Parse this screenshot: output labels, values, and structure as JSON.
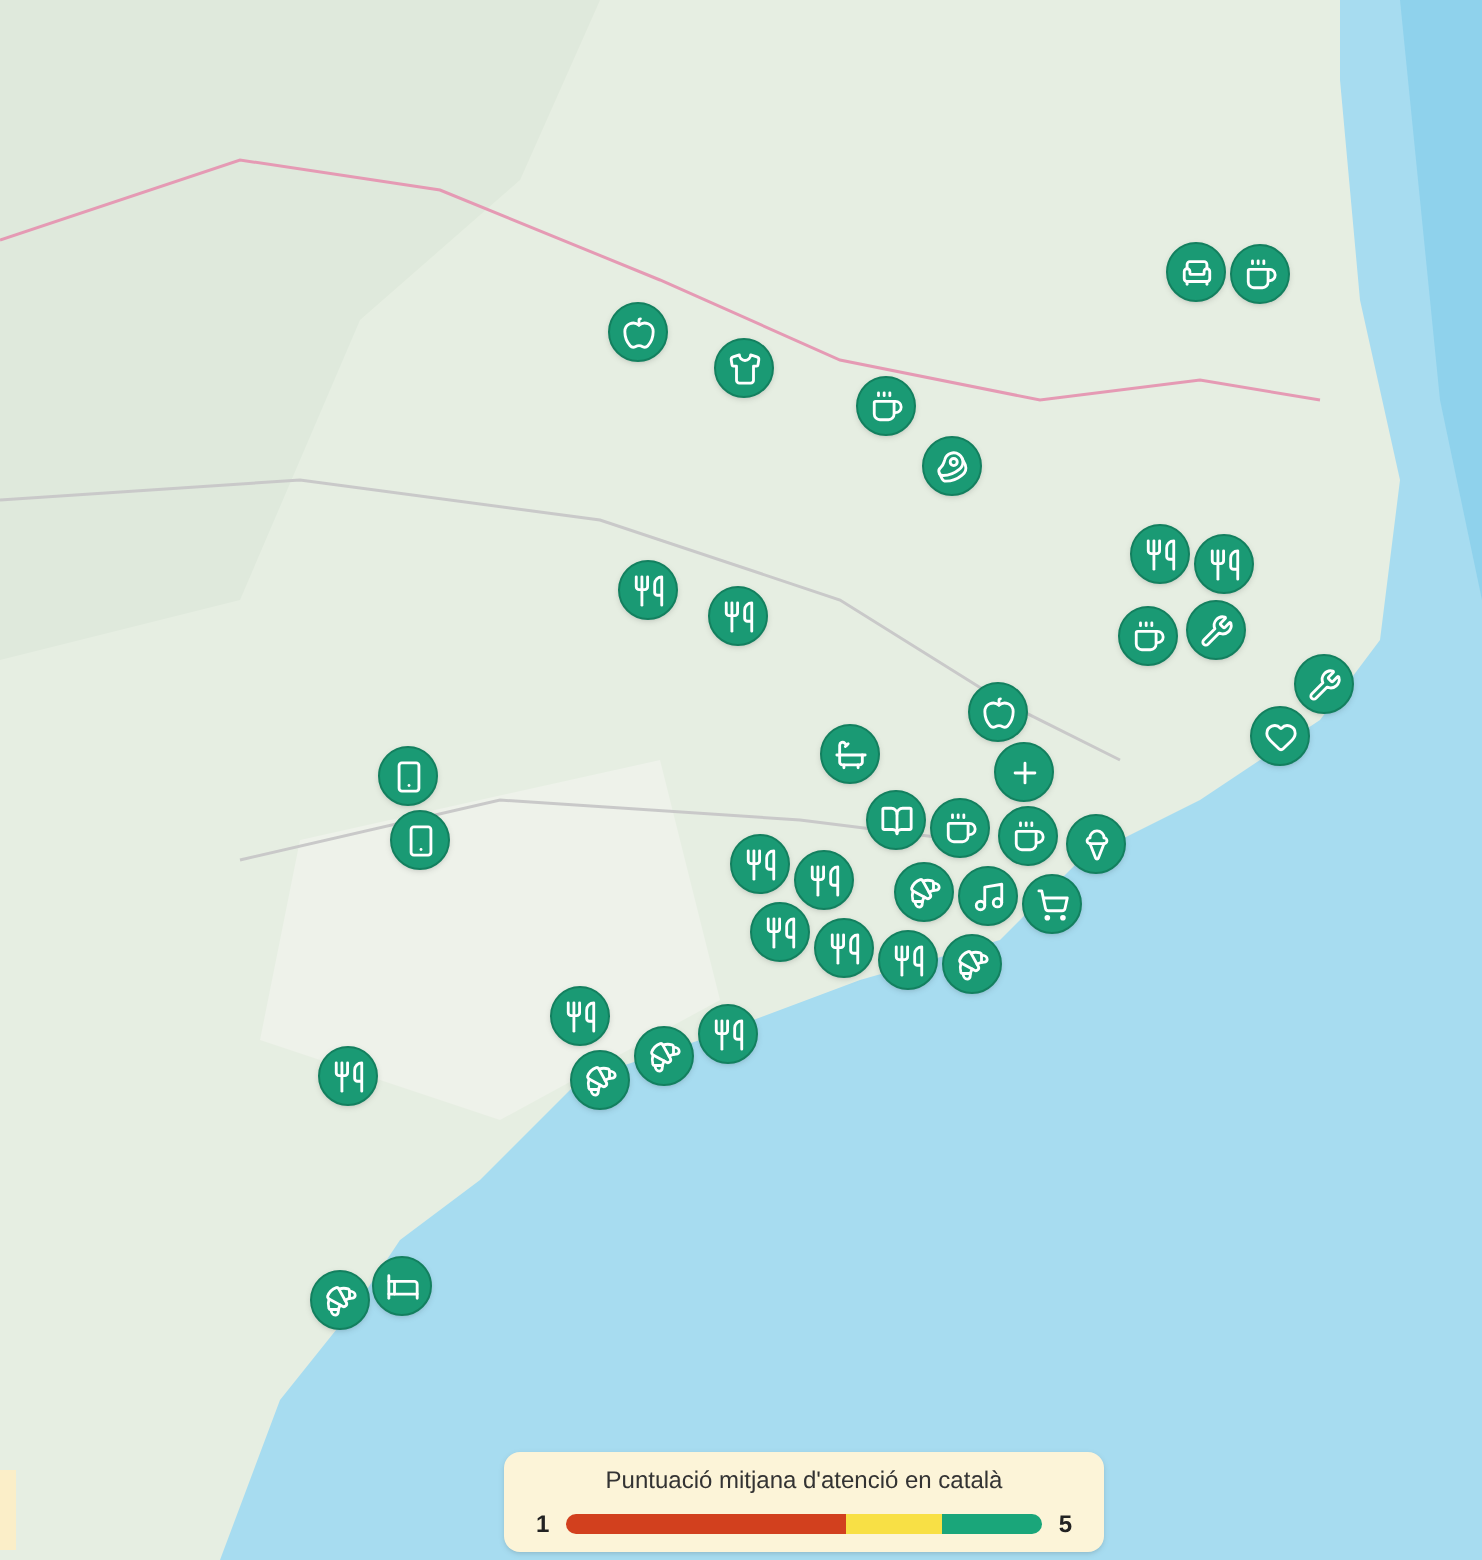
{
  "legend": {
    "title": "Puntuació mitjana d'atenció en català",
    "min_label": "1",
    "max_label": "5"
  }
}
